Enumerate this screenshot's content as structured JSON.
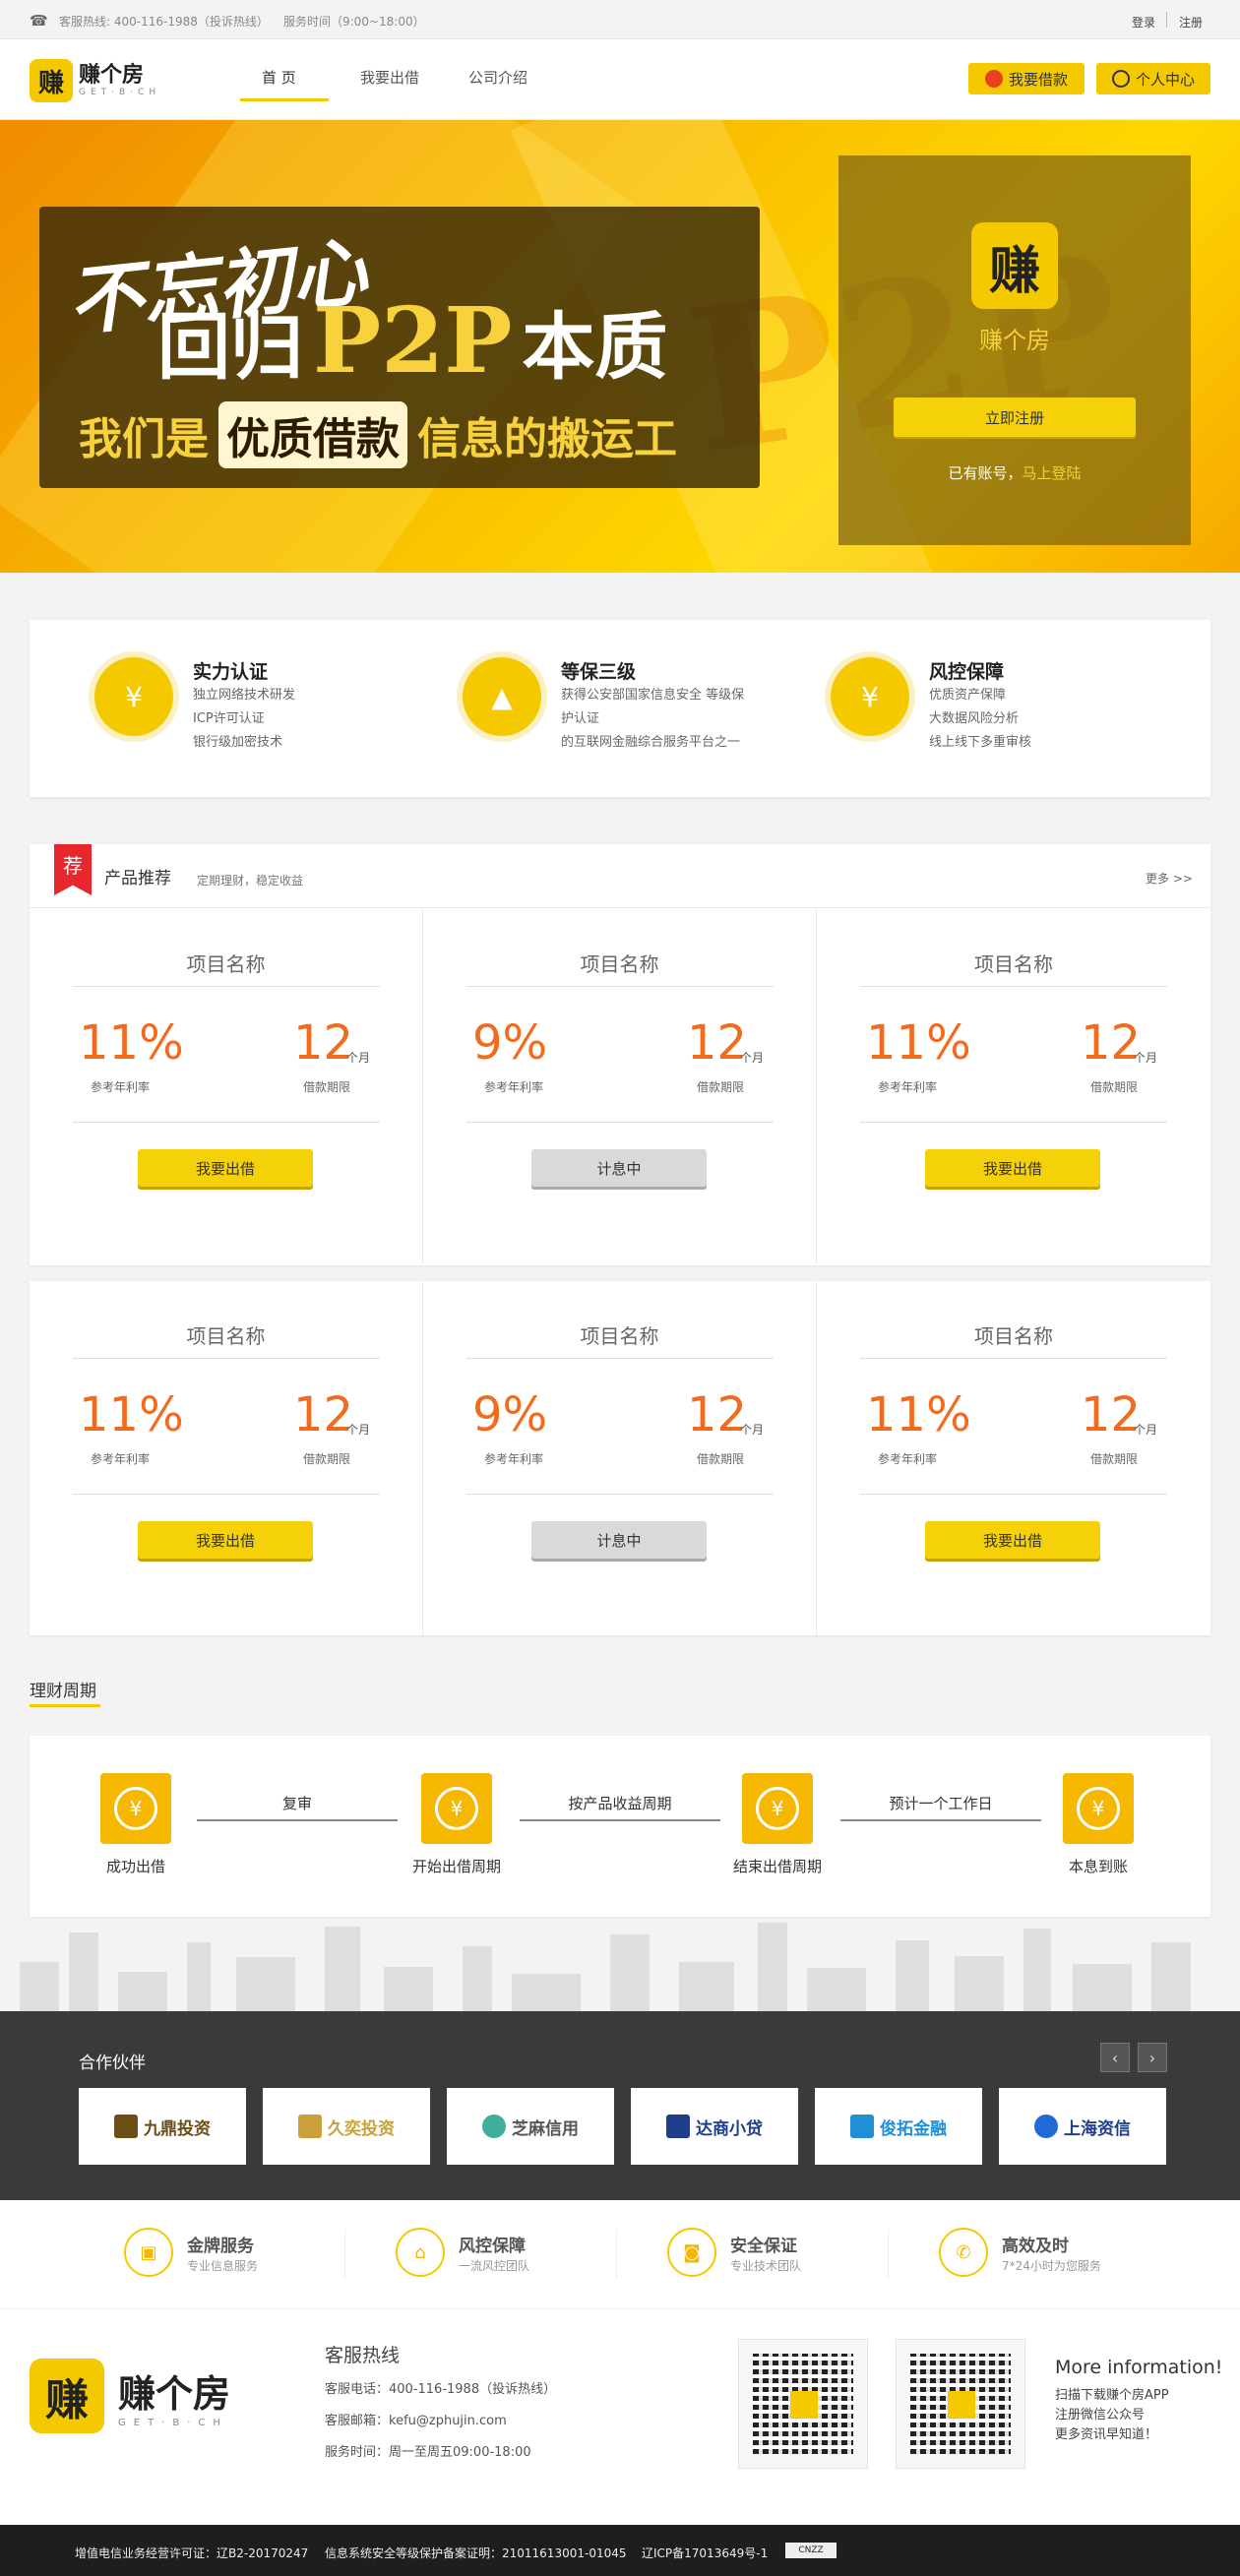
{
  "topbar": {
    "hotline": "客服热线: 400-116-1988（投诉热线）",
    "service_time": "服务时间（9:00~18:00）",
    "login": "登录",
    "register": "注册"
  },
  "header": {
    "logo_cn": "赚个房",
    "logo_en": "GET·B·CH",
    "nav": [
      "首 页",
      "我要出借",
      "公司介绍"
    ],
    "loan_btn": "我要借款",
    "user_btn": "个人中心"
  },
  "banner": {
    "line1": "不忘初心",
    "line2a": "回归",
    "line2b": "P2P",
    "line2c": "本质",
    "line3a": "我们是",
    "line3b": "优质借款",
    "line3c": "信息的搬运工",
    "brand": "赚个房",
    "register_btn": "立即注册",
    "has_account": "已有账号，",
    "login_now": "马上登陆"
  },
  "features": [
    {
      "title": "实力认证",
      "lines": [
        "独立网络技术研发",
        "ICP许可认证",
        "银行级加密技术"
      ]
    },
    {
      "title": "等保三级",
      "lines": [
        "获得公安部国家信息安全 等级保",
        "护认证",
        "的互联网金融综合服务平台之一"
      ]
    },
    {
      "title": "风控保障",
      "lines": [
        "优质资产保障",
        "大数据风险分析",
        "线上线下多重审核"
      ]
    }
  ],
  "products": {
    "badge": "荐",
    "title": "产品推荐",
    "subtitle": "定期理财，稳定收益",
    "more": "更多 >>",
    "rate_label": "参考年利率",
    "term_label": "借款期限",
    "term_unit": "个月",
    "items": [
      {
        "name": "项目名称",
        "rate": "11%",
        "term": "12",
        "btn": "我要出借",
        "status": "buy"
      },
      {
        "name": "项目名称",
        "rate": "9%",
        "term": "12",
        "btn": "计息中",
        "status": "wait"
      },
      {
        "name": "项目名称",
        "rate": "11%",
        "term": "12",
        "btn": "我要出借",
        "status": "buy"
      },
      {
        "name": "项目名称",
        "rate": "11%",
        "term": "12",
        "btn": "我要出借",
        "status": "buy"
      },
      {
        "name": "项目名称",
        "rate": "9%",
        "term": "12",
        "btn": "计息中",
        "status": "wait"
      },
      {
        "name": "项目名称",
        "rate": "11%",
        "term": "12",
        "btn": "我要出借",
        "status": "buy"
      }
    ]
  },
  "cycle": {
    "title": "理财周期",
    "steps": [
      "成功出借",
      "开始出借周期",
      "结束出借周期",
      "本息到账"
    ],
    "arrows": [
      "复审",
      "按产品收益周期",
      "预计一个工作日"
    ]
  },
  "partners": {
    "title": "合作伙伴",
    "logos": [
      "九鼎投资",
      "久奕投资",
      "芝麻信用",
      "达商小贷",
      "俊拓金融",
      "上海资信"
    ]
  },
  "services": [
    {
      "title": "金牌服务",
      "sub": "专业信息服务"
    },
    {
      "title": "风控保障",
      "sub": "一流风控团队"
    },
    {
      "title": "安全保证",
      "sub": "专业技术团队"
    },
    {
      "title": "高效及时",
      "sub": "7*24小时为您服务"
    }
  ],
  "footer": {
    "hotline_title": "客服热线",
    "phone": "客服电话：400-116-1988（投诉热线）",
    "email": "客服邮箱：kefu@zphujin.com",
    "hours": "服务时间：周一至周五09:00-18:00",
    "more_title": "More information!",
    "more_lines": [
      "扫描下载赚个房APP",
      "注册微信公众号",
      "更多资讯早知道！"
    ]
  },
  "bottom": {
    "icp_license": "增值电信业务经营许可证：辽B2-20170247",
    "security": "信息系统安全等级保护备案证明：21011613001-01045",
    "icp": "辽ICP备17013649号-1",
    "cnzz": "CNZZ"
  }
}
